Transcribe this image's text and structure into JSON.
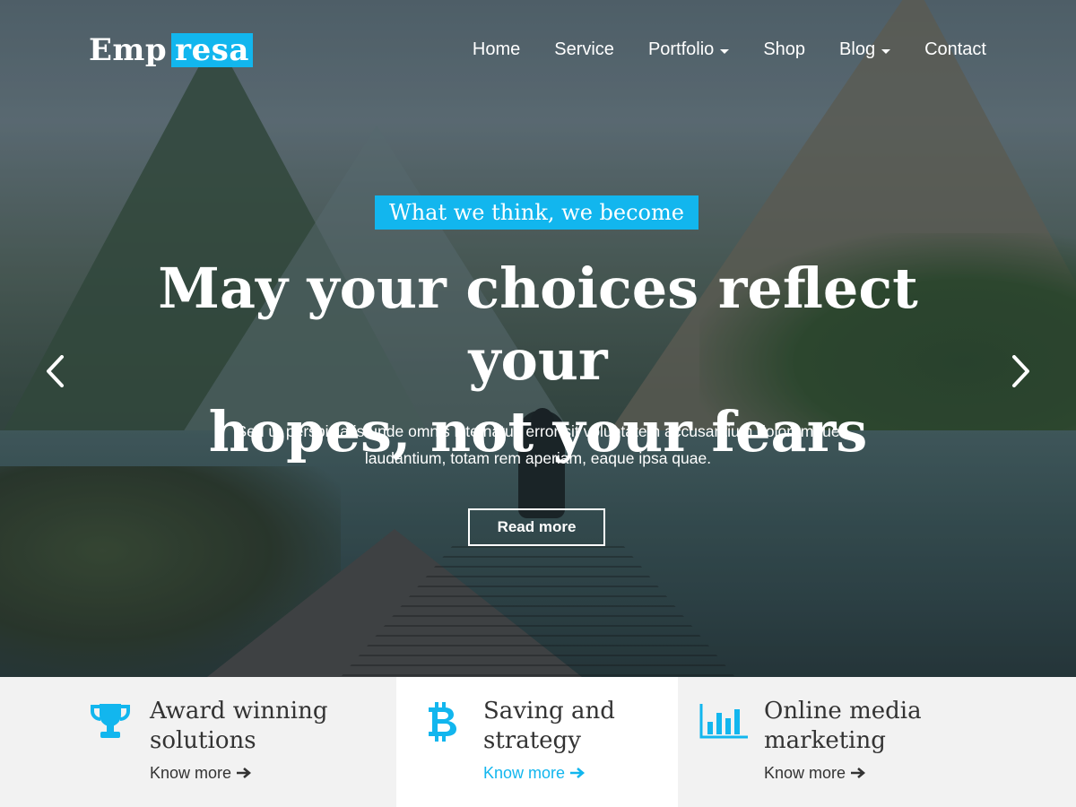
{
  "brand": {
    "part1": "Emp",
    "part2": "resa",
    "accent": "#12b6ee"
  },
  "nav": {
    "items": [
      {
        "label": "Home",
        "dropdown": false
      },
      {
        "label": "Service",
        "dropdown": false
      },
      {
        "label": "Portfolio",
        "dropdown": true
      },
      {
        "label": "Shop",
        "dropdown": false
      },
      {
        "label": "Blog",
        "dropdown": true
      },
      {
        "label": "Contact",
        "dropdown": false
      }
    ]
  },
  "hero": {
    "tagline": "What we think, we become",
    "headline_line1": "May your choices reflect your",
    "headline_line2": "hopes, not your fears",
    "subtext_line1": "Sed ut perspiciatis unde omnis iste natus error sit voluptatem accusantium doloremque",
    "subtext_line2": "laudantium, totam rem aperiam, eaque ipsa quae.",
    "cta": "Read more",
    "prev_icon": "chevron-left-icon",
    "next_icon": "chevron-right-icon"
  },
  "features": [
    {
      "icon": "trophy-icon",
      "title_line1": "Award winning",
      "title_line2": "solutions",
      "link": "Know more",
      "active": false
    },
    {
      "icon": "bitcoin-icon",
      "title_line1": "Saving and",
      "title_line2": "strategy",
      "link": "Know more",
      "active": true
    },
    {
      "icon": "bar-chart-icon",
      "title_line1": "Online media",
      "title_line2": "marketing",
      "link": "Know more",
      "active": false
    }
  ]
}
